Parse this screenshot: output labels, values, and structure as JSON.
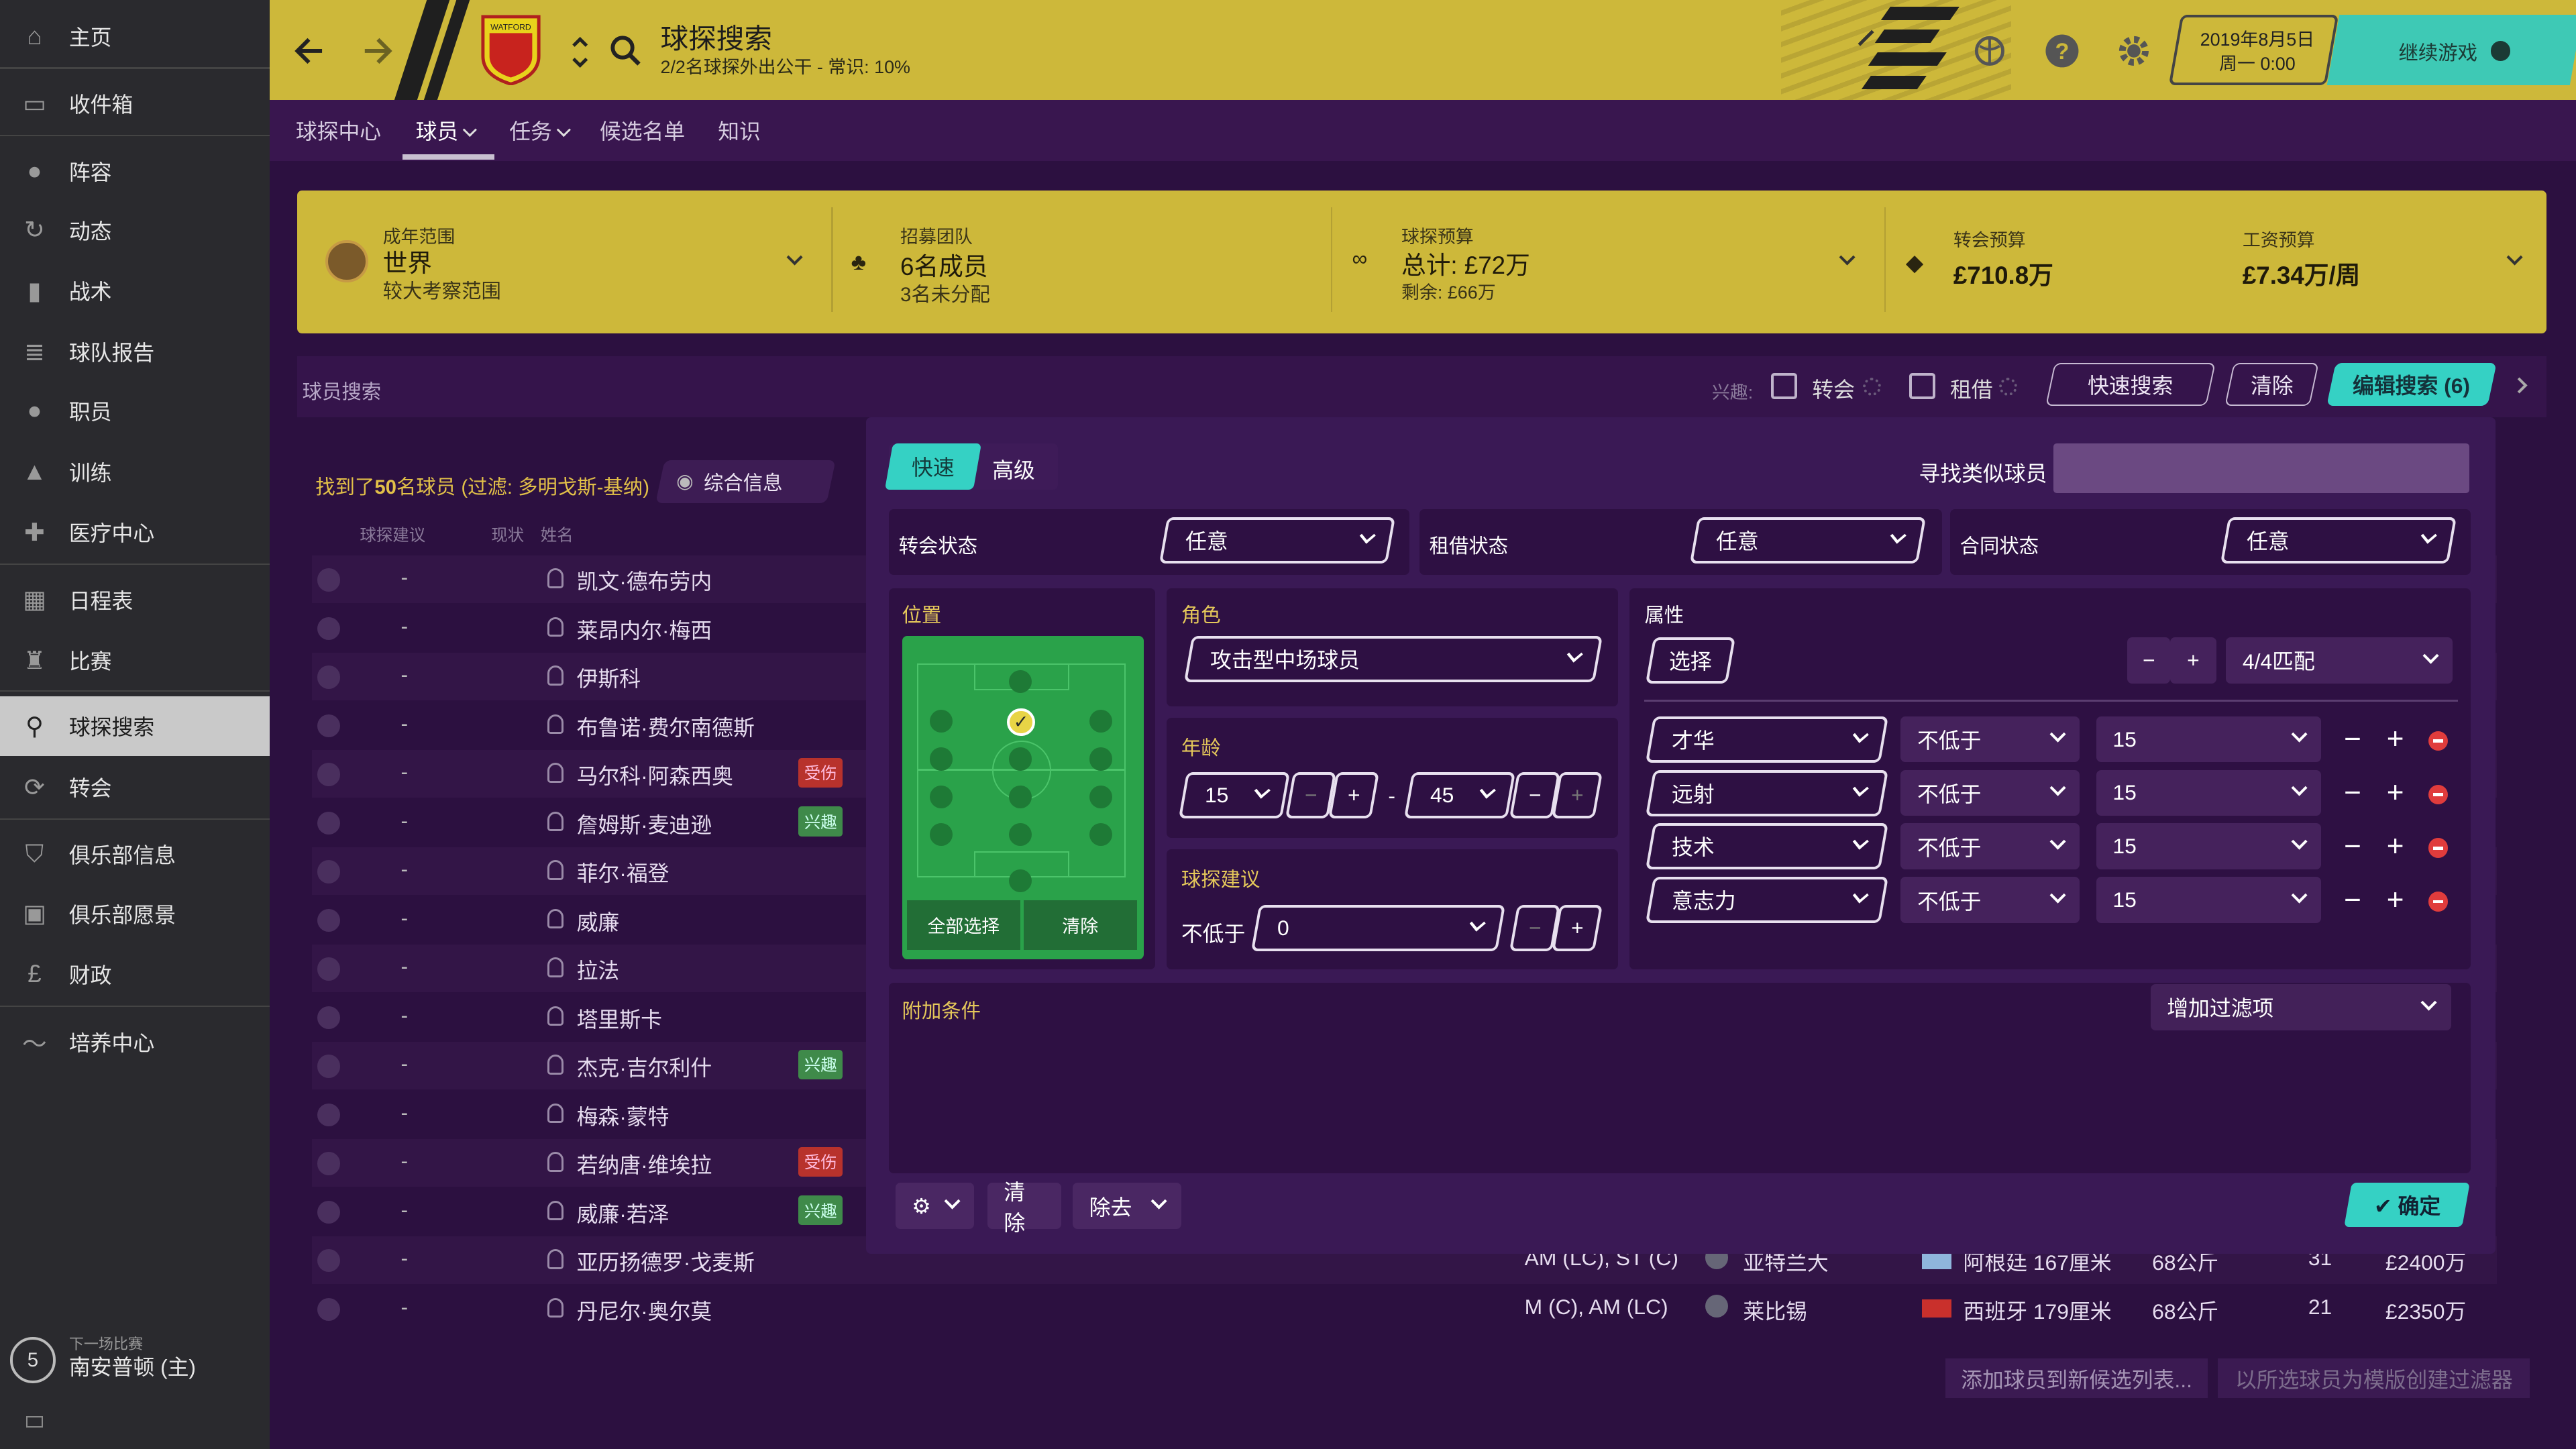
{
  "sidebar": {
    "items": [
      {
        "label": "主页",
        "icon": "home-icon"
      },
      {
        "label": "收件箱",
        "icon": "inbox-icon"
      },
      {
        "label": "阵容",
        "icon": "squad-icon"
      },
      {
        "label": "动态",
        "icon": "dynamics-icon"
      },
      {
        "label": "战术",
        "icon": "tactics-icon"
      },
      {
        "label": "球队报告",
        "icon": "report-icon"
      },
      {
        "label": "职员",
        "icon": "staff-icon"
      },
      {
        "label": "训练",
        "icon": "training-icon"
      },
      {
        "label": "医疗中心",
        "icon": "medical-icon"
      },
      {
        "label": "日程表",
        "icon": "calendar-icon"
      },
      {
        "label": "比赛",
        "icon": "trophy-icon"
      },
      {
        "label": "球探搜索",
        "icon": "search-icon"
      },
      {
        "label": "转会",
        "icon": "transfer-icon"
      },
      {
        "label": "俱乐部信息",
        "icon": "shield-icon"
      },
      {
        "label": "俱乐部愿景",
        "icon": "briefcase-icon"
      },
      {
        "label": "财政",
        "icon": "money-icon"
      },
      {
        "label": "培养中心",
        "icon": "development-icon"
      }
    ],
    "next_match_label": "下一场比赛",
    "next_match_days": "5",
    "next_match": "南安普顿 (主)"
  },
  "header": {
    "title": "球探搜索",
    "subtitle": "2/2名球探外出公干 - 常识: 10%",
    "date": "2019年8月5日",
    "time": "周一 0:00",
    "continue": "继续游戏",
    "club_badge_text": "WATFORD"
  },
  "tabs": [
    {
      "label": "球探中心"
    },
    {
      "label": "球员"
    },
    {
      "label": "任务"
    },
    {
      "label": "候选名单"
    },
    {
      "label": "知识"
    }
  ],
  "budget": {
    "range_label": "成年范围",
    "range_value": "世界",
    "range_sub": "较大考察范围",
    "team_label": "招募团队",
    "team_value": "6名成员",
    "team_sub": "3名未分配",
    "scout_label": "球探预算",
    "scout_value": "总计: £72万",
    "scout_sub": "剩余: £66万",
    "transfer_label": "转会预算",
    "transfer_value": "£710.8万",
    "wage_label": "工资预算",
    "wage_value": "£7.34万/周"
  },
  "filter_bar": {
    "title": "球员搜索",
    "interest": "兴趣:",
    "transfer": "转会",
    "loan": "租借",
    "quick_search": "快速搜索",
    "clear": "清除",
    "edit_search": "编辑搜索 (6)"
  },
  "results": {
    "found_prefix": "找到了",
    "found_count": "50",
    "found_suffix": "名球员 (过滤: 多明戈斯-基纳)",
    "view": "综合信息",
    "col_rec": "球探建议",
    "col_status": "现状",
    "col_name": "姓名",
    "rows": [
      {
        "rec": "-",
        "status": "",
        "name": "凯文·德布劳内"
      },
      {
        "rec": "-",
        "status": "",
        "name": "莱昂内尔·梅西"
      },
      {
        "rec": "-",
        "status": "",
        "name": "伊斯科"
      },
      {
        "rec": "-",
        "status": "",
        "name": "布鲁诺·费尔南德斯"
      },
      {
        "rec": "-",
        "status": "受伤",
        "name": "马尔科·阿森西奥"
      },
      {
        "rec": "-",
        "status": "兴趣",
        "name": "詹姆斯·麦迪逊"
      },
      {
        "rec": "-",
        "status": "",
        "name": "菲尔·福登"
      },
      {
        "rec": "-",
        "status": "",
        "name": "威廉"
      },
      {
        "rec": "-",
        "status": "",
        "name": "拉法"
      },
      {
        "rec": "-",
        "status": "",
        "name": "塔里斯卡"
      },
      {
        "rec": "-",
        "status": "兴趣",
        "name": "杰克·吉尔利什"
      },
      {
        "rec": "-",
        "status": "",
        "name": "梅森·蒙特"
      },
      {
        "rec": "-",
        "status": "受伤",
        "name": "若纳唐·维埃拉"
      },
      {
        "rec": "-",
        "status": "兴趣",
        "name": "威廉·若泽"
      },
      {
        "rec": "-",
        "status": "",
        "name": "亚历扬德罗·戈麦斯",
        "pos": "AM (LC), ST (C)",
        "club": "亚特兰大",
        "nation": "阿根廷 167厘米",
        "weight": "68公斤",
        "age": "31",
        "value": "£2400万"
      },
      {
        "rec": "-",
        "status": "",
        "name": "丹尼尔·奥尔莫",
        "pos": "M (C), AM (LC)",
        "club": "莱比锡",
        "nation": "西班牙 179厘米",
        "weight": "68公斤",
        "age": "21",
        "value": "£2350万"
      }
    ],
    "add_shortlist": "添加球员到新候选列表...",
    "create_filter": "以所选球员为模版创建过滤器"
  },
  "panel": {
    "tab_quick": "快速",
    "tab_adv": "高级",
    "similar_label": "寻找类似球员",
    "similar_placeholder": "",
    "transfer_status": "转会状态",
    "loan_status": "租借状态",
    "contract_status": "合同状态",
    "any": "任意",
    "position": "位置",
    "select_all": "全部选择",
    "clear": "清除",
    "role": "角色",
    "role_value": "攻击型中场球员",
    "age": "年龄",
    "age_min": "15",
    "age_max": "45",
    "scout_rec": "球探建议",
    "not_less": "不低于",
    "rec_value": "0",
    "attributes": "属性",
    "select": "选择",
    "match": "4/4匹配",
    "attr_rows": [
      {
        "name": "才华",
        "cond": "不低于",
        "val": "15"
      },
      {
        "name": "远射",
        "cond": "不低于",
        "val": "15"
      },
      {
        "name": "技术",
        "cond": "不低于",
        "val": "15"
      },
      {
        "name": "意志力",
        "cond": "不低于",
        "val": "15"
      }
    ],
    "extra": "附加条件",
    "add_filter": "增加过滤项",
    "clear_btn": "清除",
    "remove": "除去",
    "confirm": "确定"
  },
  "colors": {
    "accent": "#cdb83a",
    "purple": "#2c1040",
    "teal": "#35d1c4"
  }
}
